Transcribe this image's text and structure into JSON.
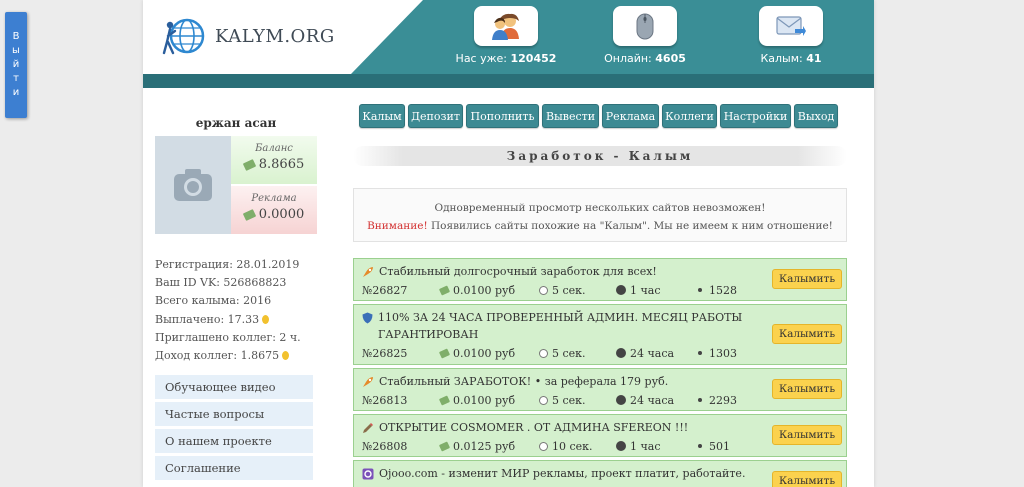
{
  "exit_tab": {
    "letters": [
      "В",
      "ы",
      "й",
      "т",
      "и"
    ]
  },
  "header": {
    "logo_text": "KALYM.ORG",
    "stats": [
      {
        "label": "Нас уже:",
        "value": "120452",
        "icon": "users-icon"
      },
      {
        "label": "Онлайн:",
        "value": "4605",
        "icon": "mouse-icon"
      },
      {
        "label": "Калым:",
        "value": "41",
        "icon": "mail-icon"
      }
    ]
  },
  "profile": {
    "name": "ержан асан",
    "balance_label": "Баланс",
    "balance_value": "8.8665",
    "ads_label": "Реклама",
    "ads_value": "0.0000"
  },
  "stats_list": {
    "registration": "Регистрация: 28.01.2019",
    "vk_id": "Ваш ID VK: 526868823",
    "total": "Всего калыма: 2016",
    "paid": "Выплачено: 17.33",
    "invited": "Приглашено коллег: 2 ч.",
    "income": "Доход коллег: 1.8675"
  },
  "side_links": [
    "Обучающее видео",
    "Частые вопросы",
    "О нашем проекте",
    "Соглашение"
  ],
  "nav": [
    "Калым",
    "Депозит",
    "Пополнить",
    "Вывести",
    "Реклама",
    "Коллеги",
    "Настройки",
    "Выход"
  ],
  "section_title": "Заработок - Калым",
  "notice": {
    "line1": "Одновременный просмотр нескольких сайтов невозможен!",
    "warn": "Внимание!",
    "line2": " Появились сайты похожие на \"Калым\". Мы не имеем к ним отношение!"
  },
  "colors": {
    "teal": "#3a8e96",
    "teal_dark": "#2a6f78",
    "task_green": "#d4f0cd",
    "button_yellow": "#fbd24e",
    "warn_red": "#d23131"
  },
  "tasks": [
    {
      "icon": "rocket-icon",
      "title": "Стабильный долгосрочный заработок для всех!",
      "num": "№26827",
      "price": "0.0100 руб",
      "sec": "5 сек.",
      "period": "1 час",
      "views": "1528",
      "button": "Калымить"
    },
    {
      "icon": "shield-icon",
      "title": "110% ЗА 24 ЧАСА ПРОВЕРЕННЫЙ АДМИН. МЕСЯЦ РАБОТЫ ГАРАНТИРОВАН",
      "num": "№26825",
      "price": "0.0100 руб",
      "sec": "5 сек.",
      "period": "24 часа",
      "views": "1303",
      "button": "Калымить"
    },
    {
      "icon": "rocket-icon",
      "title": "Стабильный ЗАРАБОТОК! • за реферала 179 руб.",
      "num": "№26813",
      "price": "0.0100 руб",
      "sec": "5 сек.",
      "period": "24 часа",
      "views": "2293",
      "button": "Калымить"
    },
    {
      "icon": "pencil-icon",
      "title": "ОТКРЫТИЕ COSMOMER . ОТ АДМИНА SFEREON !!!",
      "num": "№26808",
      "price": "0.0125 руб",
      "sec": "10 сек.",
      "period": "1 час",
      "views": "501",
      "button": "Калымить"
    },
    {
      "icon": "ojooo-icon",
      "title": "Ojooo.com - изменит МИР рекламы, проект платит, работайте.",
      "num": "",
      "price": "",
      "sec": "",
      "period": "",
      "views": "",
      "button": "Калымить"
    }
  ]
}
